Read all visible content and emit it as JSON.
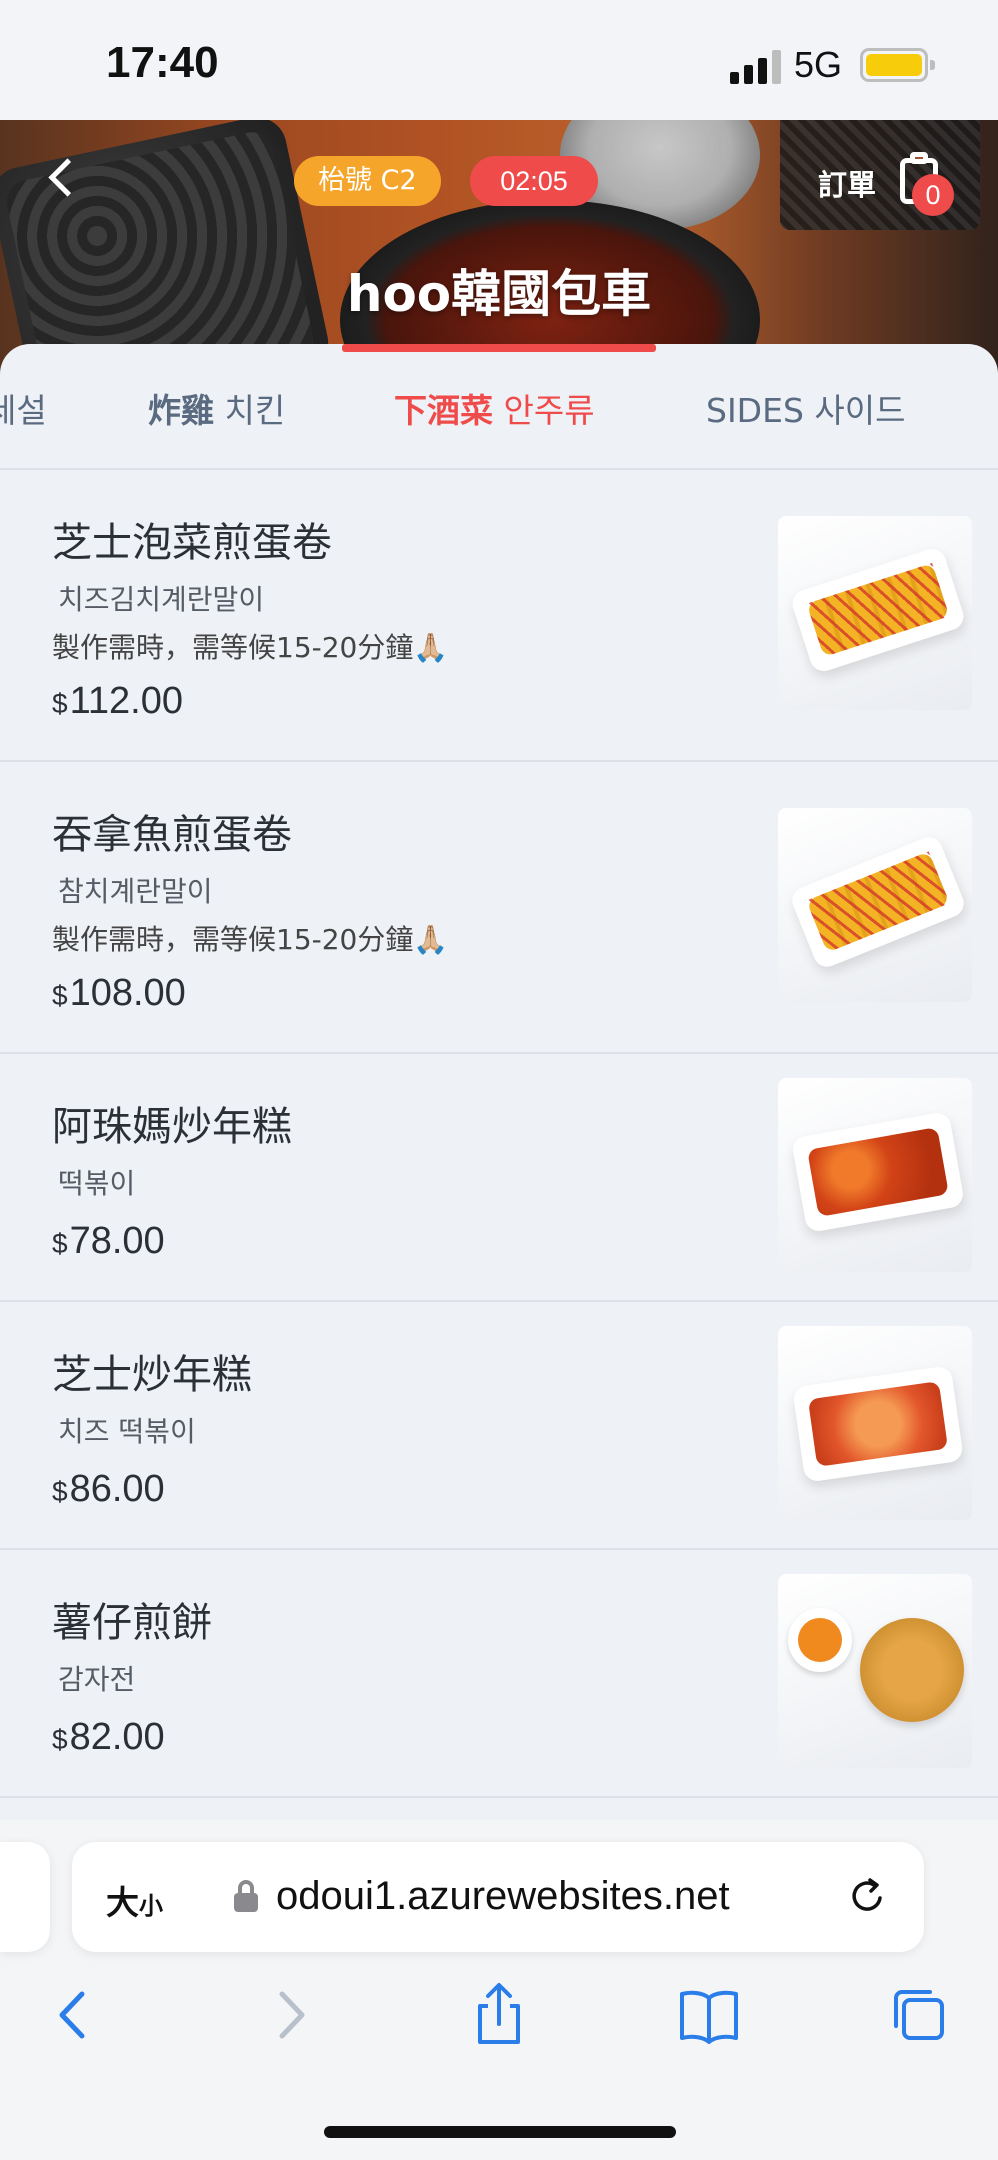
{
  "status": {
    "time": "17:40",
    "network": "5G"
  },
  "header": {
    "table_badge": "枱號 C2",
    "timer": "02:05",
    "order_label": "訂單",
    "order_count": "0",
    "store_name": "hoo韓國包車"
  },
  "tabs": [
    {
      "zh": "",
      "ko": "세설"
    },
    {
      "zh": "炸雞",
      "ko": "치킨"
    },
    {
      "zh": "下酒菜",
      "ko": "안주류",
      "active": true
    },
    {
      "zh": "SIDES",
      "ko": "사이드"
    }
  ],
  "items": [
    {
      "name": "芝士泡菜煎蛋卷",
      "sub": "치즈김치계란말이",
      "note": "製作需時，需等候15-20分鐘🙏🏼",
      "currency": "$",
      "price": "112.00"
    },
    {
      "name": "吞拿魚煎蛋卷",
      "sub": "참치계란말이",
      "note": "製作需時，需等候15-20分鐘🙏🏼",
      "currency": "$",
      "price": "108.00"
    },
    {
      "name": "阿珠媽炒年糕",
      "sub": "떡볶이",
      "currency": "$",
      "price": "78.00"
    },
    {
      "name": "芝士炒年糕",
      "sub": "치즈 떡볶이",
      "currency": "$",
      "price": "86.00"
    },
    {
      "name": "薯仔煎餅",
      "sub": "감자전",
      "currency": "$",
      "price": "82.00"
    }
  ],
  "browser": {
    "text_size_big": "大",
    "text_size_small": "小",
    "url": "odoui1.azurewebsites.net"
  },
  "colors": {
    "accent": "#ef4b4b",
    "badge": "#f6a52b",
    "toolbar_icon": "#2b7de9"
  },
  "icons": [
    "back-icon",
    "clipboard-icon",
    "lock-icon",
    "reload-icon",
    "chevron-left-icon",
    "chevron-right-icon",
    "share-icon",
    "bookmarks-icon",
    "tabs-icon"
  ]
}
